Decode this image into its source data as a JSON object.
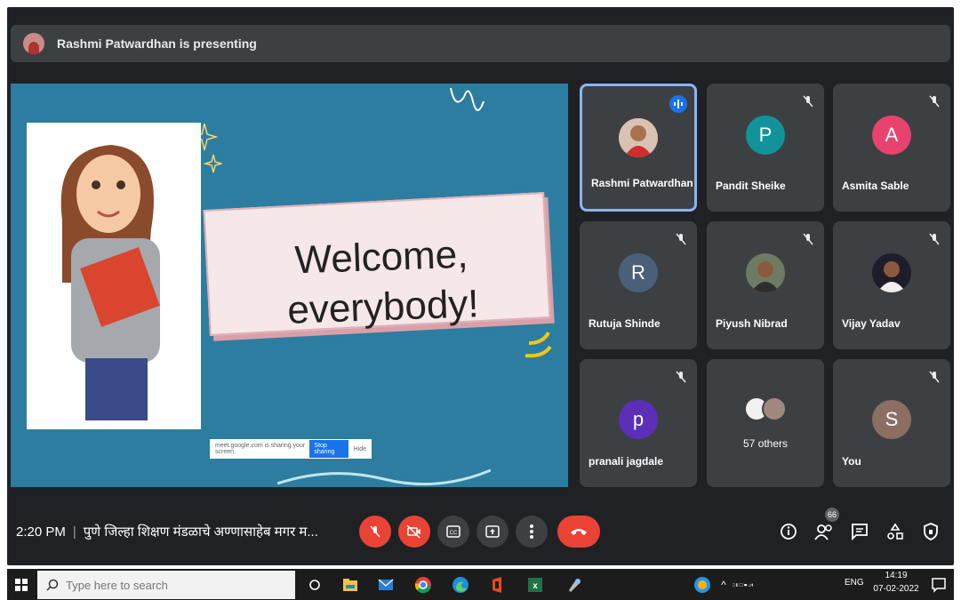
{
  "meeting": {
    "presenting_text": "Rashmi Patwardhan is presenting",
    "time": "2:20 PM",
    "meeting_title": "पुणे जिल्हा शिक्षण मंडळाचे अण्णासाहेब मगर म...",
    "people_count": "66"
  },
  "slide": {
    "heading_line1": "Welcome,",
    "heading_line2": "everybody!",
    "share_text": "meet.google.com is sharing your screen.",
    "stop_label": "Stop sharing",
    "hide_label": "Hide"
  },
  "participants": [
    {
      "name": "Rashmi Patwardhan",
      "type": "photo",
      "speaking": true
    },
    {
      "name": "Pandit Sheike",
      "initial": "P",
      "color": "#12939a"
    },
    {
      "name": "Asmita Sable",
      "initial": "A",
      "color": "#e8436f"
    },
    {
      "name": "Rutuja Shinde",
      "initial": "R",
      "color": "#4a6078"
    },
    {
      "name": "Piyush Nibrad",
      "type": "photo"
    },
    {
      "name": "Vijay Yadav",
      "type": "photo"
    },
    {
      "name": "pranali jagdale",
      "initial": "p",
      "color": "#5b2fb8"
    },
    {
      "name": "57 others",
      "type": "others"
    },
    {
      "name": "You",
      "initial": "S",
      "color": "#8d6e63"
    }
  ],
  "taskbar": {
    "search_placeholder": "Type here to search",
    "lang": "ENG",
    "clock_time": "14:19",
    "clock_date": "07-02-2022"
  }
}
